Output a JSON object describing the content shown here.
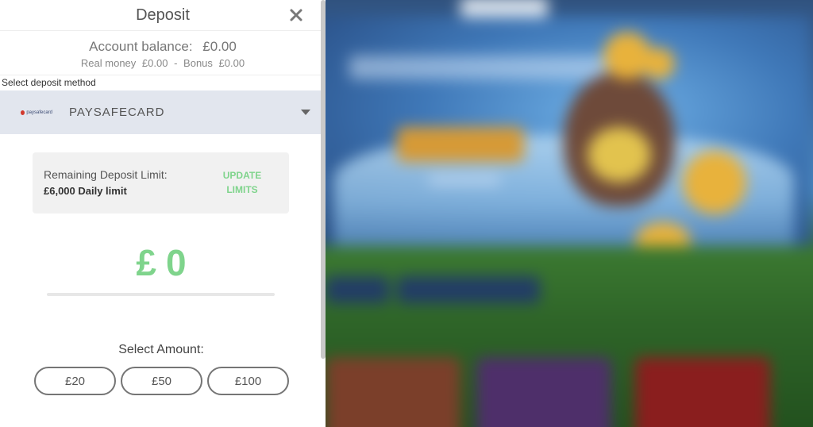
{
  "deposit": {
    "title": "Deposit",
    "balance_label": "Account balance:",
    "balance_value": "£0.00",
    "real_money_label": "Real money",
    "real_money_value": "£0.00",
    "separator": "-",
    "bonus_label": "Bonus",
    "bonus_value": "£0.00",
    "method_label": "Select deposit method",
    "method": {
      "name": "PAYSAFECARD",
      "logo_text": "paysafecard"
    },
    "limit": {
      "title": "Remaining Deposit Limit:",
      "value": "£6,000 Daily limit",
      "update_line1": "UPDATE",
      "update_line2": "LIMITS"
    },
    "amount_currency": "£",
    "amount_value": "0",
    "select_amount_label": "Select Amount:",
    "quick_amounts": [
      "£20",
      "£50",
      "£100"
    ]
  },
  "colors": {
    "accent_green": "#7fd48c",
    "method_bg": "#e2e6ee",
    "limit_bg": "#f1f1f1"
  },
  "icons": {
    "close": "close-icon",
    "dropdown": "chevron-down-icon",
    "method_logo": "paysafecard-logo"
  }
}
